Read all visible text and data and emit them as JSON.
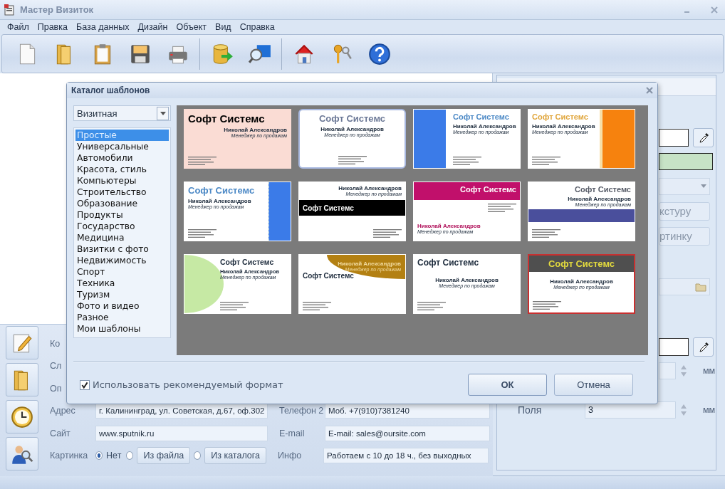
{
  "window": {
    "title": "Мастер Визиток"
  },
  "menu": [
    {
      "label": "Файл"
    },
    {
      "label": "Правка"
    },
    {
      "label": "База данных"
    },
    {
      "label": "Дизайн"
    },
    {
      "label": "Объект"
    },
    {
      "label": "Вид"
    },
    {
      "label": "Справка"
    }
  ],
  "form": {
    "rows": [
      {
        "label": "Ко"
      },
      {
        "label": "Сл"
      },
      {
        "label": "Оп"
      },
      {
        "kind": "fields",
        "label": "Адрес",
        "value": "г. Калининград, ул. Советская, д.67, оф.302",
        "label_2": "Телефон 2",
        "value_2": "Моб. +7(910)7381240"
      },
      {
        "kind": "fields",
        "label": "Сайт",
        "value": "www.sputnik.ru",
        "label_2": "E-mail",
        "value_2": "E-mail: sales@oursite.com"
      },
      {
        "kind": "picture",
        "label": "Картинка",
        "options": [
          {
            "label": "Нет",
            "kind": "text",
            "selected": true
          },
          {
            "label": "Из файла",
            "kind": "button",
            "selected": false
          },
          {
            "label": "Из каталога",
            "kind": "button",
            "selected": false
          }
        ],
        "label_2": "Инфо",
        "value_2": "Работаем с 10 до 18 ч., без выходных"
      }
    ]
  },
  "side_panel": {
    "rows": [
      {
        "kind": "picker"
      },
      {
        "kind": "swatch"
      },
      {
        "kind": "dropdown"
      },
      {
        "kind": "button",
        "label": "кстуру"
      },
      {
        "kind": "button",
        "label": "ртинку"
      },
      {
        "kind": "file"
      },
      {
        "kind": "picker"
      },
      {
        "kind": "spin",
        "unit": "мм"
      }
    ],
    "margins": {
      "label": "Поля",
      "value": "3",
      "unit": "мм"
    }
  },
  "dialog": {
    "title": "Каталог шаблонов",
    "format": {
      "value": "Визитная"
    },
    "categories": [
      {
        "label": "Простые",
        "selected": true
      },
      {
        "label": "Универсальные",
        "selected": false
      },
      {
        "label": "Автомобили",
        "selected": false
      },
      {
        "label": "Красота, стиль",
        "selected": false
      },
      {
        "label": "Компьютеры",
        "selected": false
      },
      {
        "label": "Строительство",
        "selected": false
      },
      {
        "label": "Образование",
        "selected": false
      },
      {
        "label": "Продукты",
        "selected": false
      },
      {
        "label": "Государство",
        "selected": false
      },
      {
        "label": "Медицина",
        "selected": false
      },
      {
        "label": "Визитки с фото",
        "selected": false
      },
      {
        "label": "Недвижимость",
        "selected": false
      },
      {
        "label": "Спорт",
        "selected": false
      },
      {
        "label": "Техника",
        "selected": false
      },
      {
        "label": "Туризм",
        "selected": false
      },
      {
        "label": "Фото и видео",
        "selected": false
      },
      {
        "label": "Разное",
        "selected": false
      },
      {
        "label": "Мои шаблоны",
        "selected": false
      }
    ],
    "templates": [
      {
        "kind": "pink",
        "company": "Софт Системс",
        "name": "Николай Александров",
        "position": "Менеджер по продажам",
        "highlighted": false,
        "selected": false
      },
      {
        "kind": "framed",
        "company": "Софт Системс",
        "name": "Николай Александров",
        "position": "Менеджер по продажам",
        "highlighted": true,
        "selected": false
      },
      {
        "kind": "leftbar",
        "company": "Софт Системс",
        "name": "Николай Александров",
        "position": "Менеджер по продажам",
        "highlighted": false,
        "selected": false
      },
      {
        "kind": "orangebar",
        "company": "Софт Системс",
        "name": "Николай Александров",
        "position": "Менеджер по продажам",
        "highlighted": false,
        "selected": false
      },
      {
        "kind": "bluebar",
        "company": "Софт Системс",
        "name": "Николай Александров",
        "position": "Менеджер по продажам",
        "highlighted": false,
        "selected": false
      },
      {
        "kind": "blackband",
        "company": "Софт Системс",
        "name": "Николай Александров",
        "position": "Менеджер по продажам",
        "highlighted": false,
        "selected": false
      },
      {
        "kind": "magenta",
        "company": "Софт Системс",
        "name": "Николай Александров",
        "position": "Менеджер по продажам",
        "highlighted": false,
        "selected": false
      },
      {
        "kind": "purpleband",
        "company": "Софт Системс",
        "name": "Николай Александров",
        "position": "Менеджер по продажам",
        "highlighted": false,
        "selected": false
      },
      {
        "kind": "greencurve",
        "company": "Софт Системс",
        "name": "Николай Александров",
        "position": "Менеджер по продажам",
        "highlighted": false,
        "selected": false
      },
      {
        "kind": "browncurve",
        "company": "Софт Системс",
        "name": "Николай Александров",
        "position": "Менеджер по продажам",
        "highlighted": false,
        "selected": false
      },
      {
        "kind": "plain",
        "company": "Софт Системс",
        "name": "Николай Александров",
        "position": "Менеджер по продажам",
        "highlighted": false,
        "selected": false
      },
      {
        "kind": "darkband",
        "company": "Софт Системс",
        "name": "Николай Александров",
        "position": "Менеджер по продажам",
        "highlighted": false,
        "selected": true
      }
    ],
    "recommended_format": {
      "label": "Использовать рекомендуемый формат",
      "checked": true
    },
    "buttons": [
      {
        "label": "ОК",
        "kind": "default"
      },
      {
        "label": "Отмена",
        "kind": "normal"
      }
    ]
  }
}
